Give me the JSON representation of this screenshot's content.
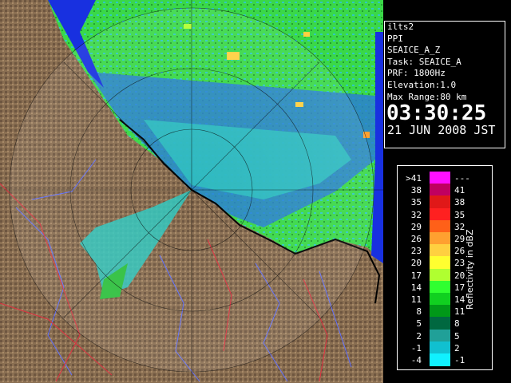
{
  "window": {
    "product": "ilts2",
    "mode": "PPI",
    "config": "SEAICE_A_Z",
    "task": "Task: SEAICE_A",
    "prf": "PRF: 1800Hz",
    "elevation": "Elevation:1.0",
    "max_range": "Max Range:80 km",
    "time": "03:30:25",
    "date": "21 JUN 2008 JST"
  },
  "legend": {
    "unit_label": "Reflectivity in dBZ",
    "bins": [
      {
        "lo": ">41",
        "hi": "---",
        "color": "#ff10ff"
      },
      {
        "lo": "38",
        "hi": "41",
        "color": "#c00060"
      },
      {
        "lo": "35",
        "hi": "38",
        "color": "#e01818"
      },
      {
        "lo": "32",
        "hi": "35",
        "color": "#ff2020"
      },
      {
        "lo": "29",
        "hi": "32",
        "color": "#ff6018"
      },
      {
        "lo": "26",
        "hi": "29",
        "color": "#ffa030"
      },
      {
        "lo": "23",
        "hi": "26",
        "color": "#ffd040"
      },
      {
        "lo": "20",
        "hi": "23",
        "color": "#ffff30"
      },
      {
        "lo": "17",
        "hi": "20",
        "color": "#b0ff30"
      },
      {
        "lo": "14",
        "hi": "17",
        "color": "#30ff30"
      },
      {
        "lo": "11",
        "hi": "14",
        "color": "#10d020"
      },
      {
        "lo": "8",
        "hi": "11",
        "color": "#009818"
      },
      {
        "lo": "5",
        "hi": "8",
        "color": "#006840"
      },
      {
        "lo": "2",
        "hi": "5",
        "color": "#20a098"
      },
      {
        "lo": "-1",
        "hi": "2",
        "color": "#10c0d0"
      },
      {
        "lo": "-4",
        "hi": "-1",
        "color": "#10f0ff"
      }
    ]
  },
  "colors": {
    "land": "#8a6f52",
    "sea": "#1830e0",
    "ice_low": "#2a7ad8",
    "ice_mid": "#30c8c0",
    "ice_high": "#40e040",
    "coast": "#000000",
    "rivers": "#6070ff",
    "roads": "#e03040"
  }
}
